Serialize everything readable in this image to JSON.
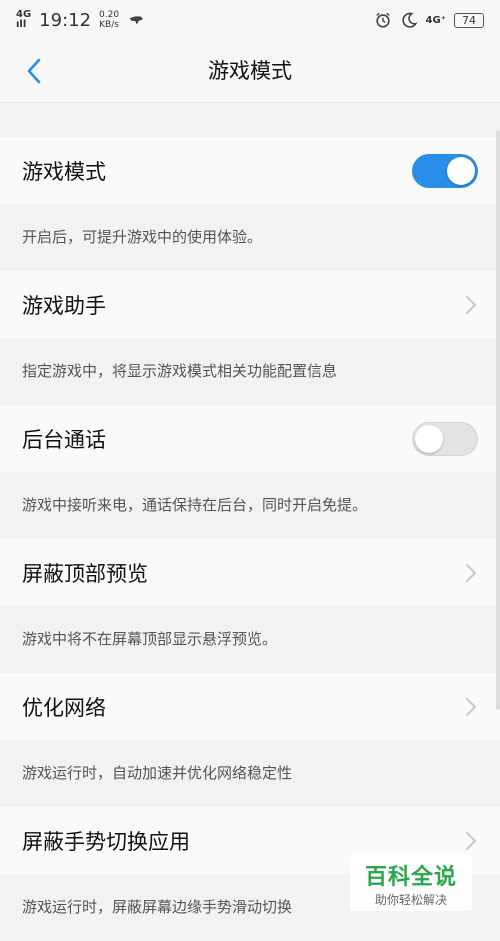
{
  "status_bar": {
    "network_type_top": "4G",
    "network_type_bottom": "ıll",
    "time": "19:12",
    "speed_value": "0.20",
    "speed_unit": "KB/s",
    "signal_right": "4G⁺",
    "battery": "74"
  },
  "nav": {
    "title": "游戏模式"
  },
  "settings": [
    {
      "title": "游戏模式",
      "desc": "开启后，可提升游戏中的使用体验。",
      "control": "toggle",
      "toggle_on": true
    },
    {
      "title": "游戏助手",
      "desc": "指定游戏中，将显示游戏模式相关功能配置信息",
      "control": "chevron"
    },
    {
      "title": "后台通话",
      "desc": "游戏中接听来电，通话保持在后台，同时开启免提。",
      "control": "toggle",
      "toggle_on": false
    },
    {
      "title": "屏蔽顶部预览",
      "desc": "游戏中将不在屏幕顶部显示悬浮预览。",
      "control": "chevron"
    },
    {
      "title": "优化网络",
      "desc": "游戏运行时，自动加速并优化网络稳定性",
      "control": "chevron"
    },
    {
      "title": "屏蔽手势切换应用",
      "desc": "游戏运行时，屏蔽屏幕边缘手势滑动切换",
      "control": "chevron"
    }
  ],
  "watermark": {
    "title": "百科全说",
    "subtitle": "助你轻松解决"
  },
  "colors": {
    "accent": "#2a8ee9",
    "watermark_green": "#2aa74a"
  }
}
